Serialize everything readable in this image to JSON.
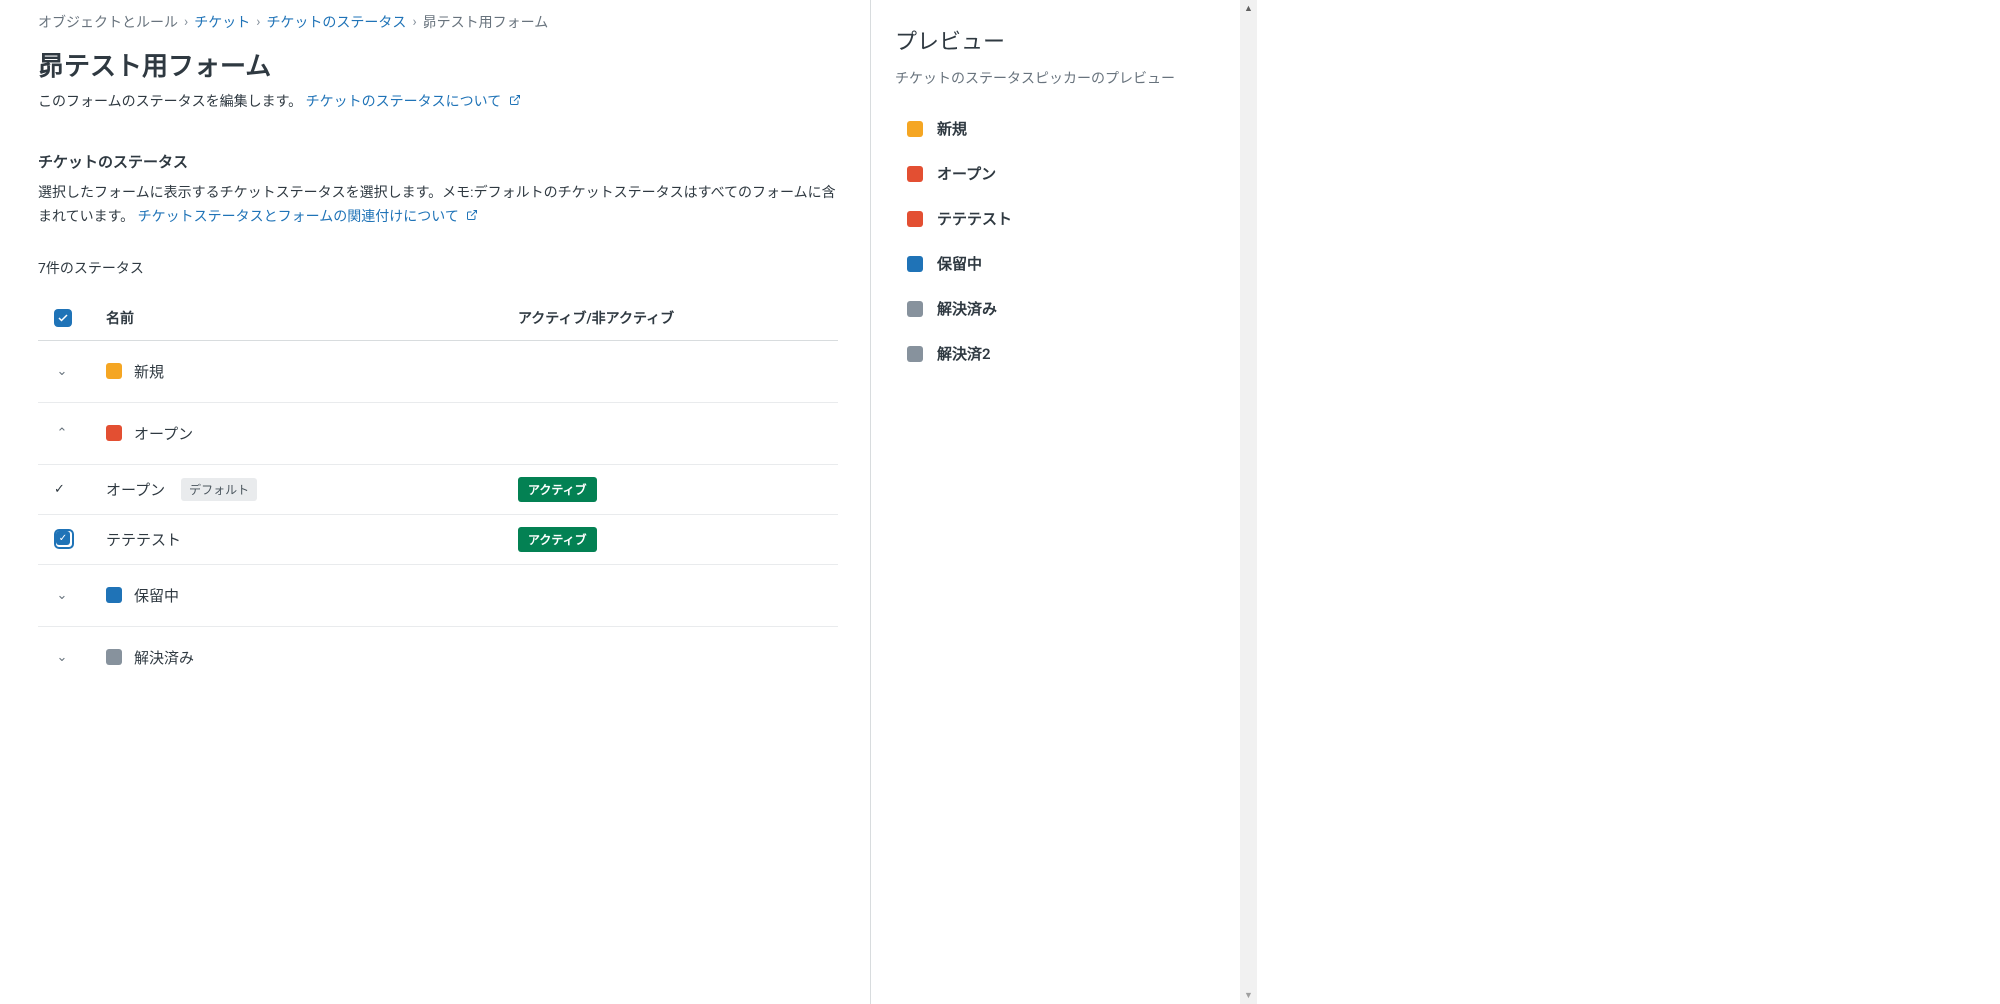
{
  "breadcrumb": {
    "item0": "オブジェクトとルール",
    "item1": "チケット",
    "item2": "チケットのステータス",
    "item3": "昴テスト用フォーム"
  },
  "page": {
    "title": "昴テスト用フォーム",
    "desc_prefix": "このフォームのステータスを編集します。",
    "desc_link": "チケットのステータスについて"
  },
  "section": {
    "title": "チケットのステータス",
    "desc_prefix": "選択したフォームに表示するチケットステータスを選択します。メモ:デフォルトのチケットステータスはすべてのフォームに含まれています。",
    "desc_link": "チケットステータスとフォームの関連付けについて"
  },
  "count_text": "7件のステータス",
  "table": {
    "header_name": "名前",
    "header_active": "アクティブ/非アクティブ",
    "default_label": "デフォルト",
    "active_label": "アクティブ"
  },
  "groups": {
    "g0": {
      "label": "新規"
    },
    "g1": {
      "label": "オープン"
    },
    "g1_item0": {
      "label": "オープン"
    },
    "g1_item1": {
      "label": "テテテスト"
    },
    "g2": {
      "label": "保留中"
    },
    "g3": {
      "label": "解決済み"
    }
  },
  "preview": {
    "title": "プレビュー",
    "desc": "チケットのステータスピッカーのプレビュー",
    "items": {
      "p0": "新規",
      "p1": "オープン",
      "p2": "テテテスト",
      "p3": "保留中",
      "p4": "解決済み",
      "p5": "解決済2"
    }
  }
}
